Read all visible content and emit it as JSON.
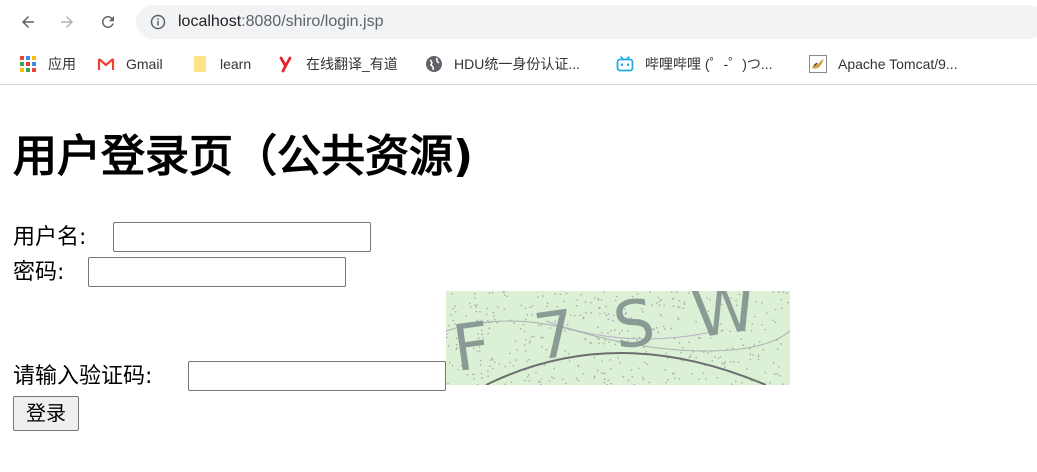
{
  "browser": {
    "url_host": "localhost",
    "url_rest": ":8080/shiro/login.jsp",
    "bookmarks": [
      {
        "label": "应用",
        "icon": "apps-grid-icon"
      },
      {
        "label": "Gmail",
        "icon": "gmail-icon"
      },
      {
        "label": "learn",
        "icon": "folder-icon"
      },
      {
        "label": "在线翻译_有道",
        "icon": "youdao-icon"
      },
      {
        "label": "HDU统一身份认证...",
        "icon": "globe-icon"
      },
      {
        "label": "哔哩哔哩 (゜-゜)つ...",
        "icon": "bilibili-icon"
      },
      {
        "label": "Apache Tomcat/9...",
        "icon": "tomcat-icon"
      }
    ]
  },
  "page": {
    "title": "用户登录页（公共资源)",
    "username_label": "用户名:",
    "password_label": "密码:",
    "captcha_label": "请输入验证码:",
    "captcha_text": "F7SW",
    "submit_label": "登录"
  },
  "colors": {
    "captcha_bg": "#dcf0d6",
    "captcha_glyph": "#8a9a94",
    "omnibox_bg": "#f1f3f4"
  }
}
